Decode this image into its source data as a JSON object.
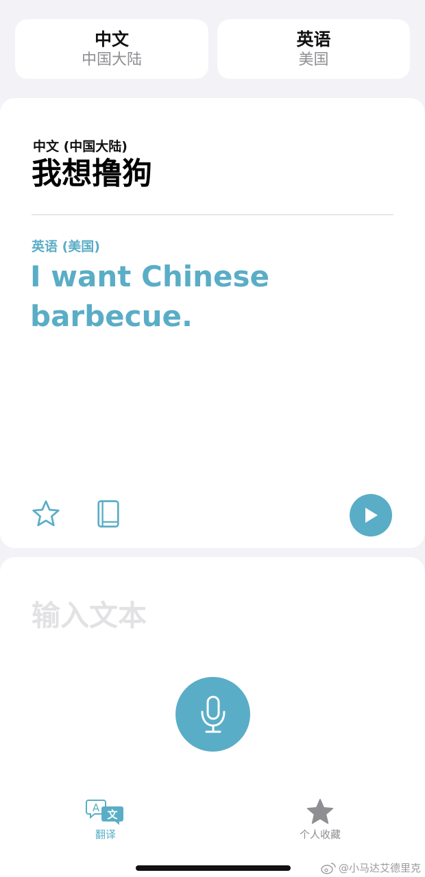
{
  "language_selector": {
    "source": {
      "name": "中文",
      "region": "中国大陆"
    },
    "target": {
      "name": "英语",
      "region": "美国"
    }
  },
  "translation": {
    "source_label": "中文 (中国大陆)",
    "source_text": "我想撸狗",
    "target_label": "英语 (美国)",
    "target_text": "I want Chinese barbecue."
  },
  "card_actions": {
    "favorite_icon": "star-outline-icon",
    "dictionary_icon": "book-icon",
    "play_icon": "play-icon"
  },
  "input": {
    "placeholder": "输入文本",
    "mic_icon": "microphone-icon"
  },
  "tabs": [
    {
      "label": "翻译",
      "icon": "translate-icon",
      "active": true
    },
    {
      "label": "个人收藏",
      "icon": "star-filled-icon",
      "active": false
    }
  ],
  "watermark": "@小马达艾德里克",
  "colors": {
    "accent": "#5aadc6",
    "background": "#f2f2f7",
    "inactive": "#8e8e93"
  }
}
